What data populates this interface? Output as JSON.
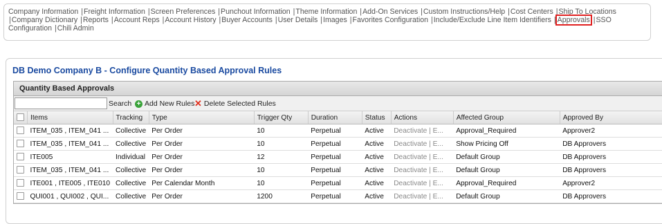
{
  "nav_links": [
    "Company Information",
    "Freight Information",
    "Screen Preferences",
    "Punchout Information",
    "Theme Information",
    "Add-On Services",
    "Custom Instructions/Help",
    "Cost Centers",
    "Ship To Locations",
    "Company Dictionary",
    "Reports",
    "Account Reps",
    "Account History",
    "Buyer Accounts",
    "User Details",
    "Images",
    "Favorites Configuration",
    "Include/Exclude Line Item Identifiers",
    "Approvals",
    "SSO Configuration",
    "Chili Admin"
  ],
  "page_title": "DB Demo Company B - Configure Quantity Based Approval Rules",
  "grid": {
    "title": "Quantity Based Approvals",
    "search_label": "Search",
    "search_value": "",
    "add_label": "Add New Rules",
    "delete_label": "Delete Selected Rules",
    "columns": [
      "Items",
      "Tracking",
      "Type",
      "Trigger Qty",
      "Duration",
      "Status",
      "Actions",
      "Affected Group",
      "Approved By"
    ],
    "rows": [
      {
        "items": "ITEM_035 , ITEM_041 ...",
        "tracking": "Collective",
        "type": "Per Order",
        "trigger": "10",
        "duration": "Perpetual",
        "status": "Active",
        "actions": "Deactivate | E...",
        "group": "Approval_Required",
        "approved": "Approver2"
      },
      {
        "items": "ITEM_035 , ITEM_041 ...",
        "tracking": "Collective",
        "type": "Per Order",
        "trigger": "10",
        "duration": "Perpetual",
        "status": "Active",
        "actions": "Deactivate | E...",
        "group": "Show Pricing Off",
        "approved": "DB Approvers"
      },
      {
        "items": "ITE005",
        "tracking": "Individual",
        "type": "Per Order",
        "trigger": "12",
        "duration": "Perpetual",
        "status": "Active",
        "actions": "Deactivate | E...",
        "group": "Default Group",
        "approved": "DB Approvers"
      },
      {
        "items": "ITEM_035 , ITEM_041 ...",
        "tracking": "Collective",
        "type": "Per Order",
        "trigger": "10",
        "duration": "Perpetual",
        "status": "Active",
        "actions": "Deactivate | E...",
        "group": "Default Group",
        "approved": "DB Approvers"
      },
      {
        "items": "ITE001 , ITE005 , ITE010",
        "tracking": "Collective",
        "type": "Per Calendar Month",
        "trigger": "10",
        "duration": "Perpetual",
        "status": "Active",
        "actions": "Deactivate | E...",
        "group": "Approval_Required",
        "approved": "Approver2"
      },
      {
        "items": "QUI001 , QUI002 , QUI...",
        "tracking": "Collective",
        "type": "Per Order",
        "trigger": "1200",
        "duration": "Perpetual",
        "status": "Active",
        "actions": "Deactivate | E...",
        "group": "Default Group",
        "approved": "DB Approvers"
      }
    ]
  },
  "colors": {
    "title_blue": "#1a4aa0",
    "highlight_red": "#e02020",
    "add_green": "#3aa33a",
    "delete_red": "#e0301e"
  }
}
